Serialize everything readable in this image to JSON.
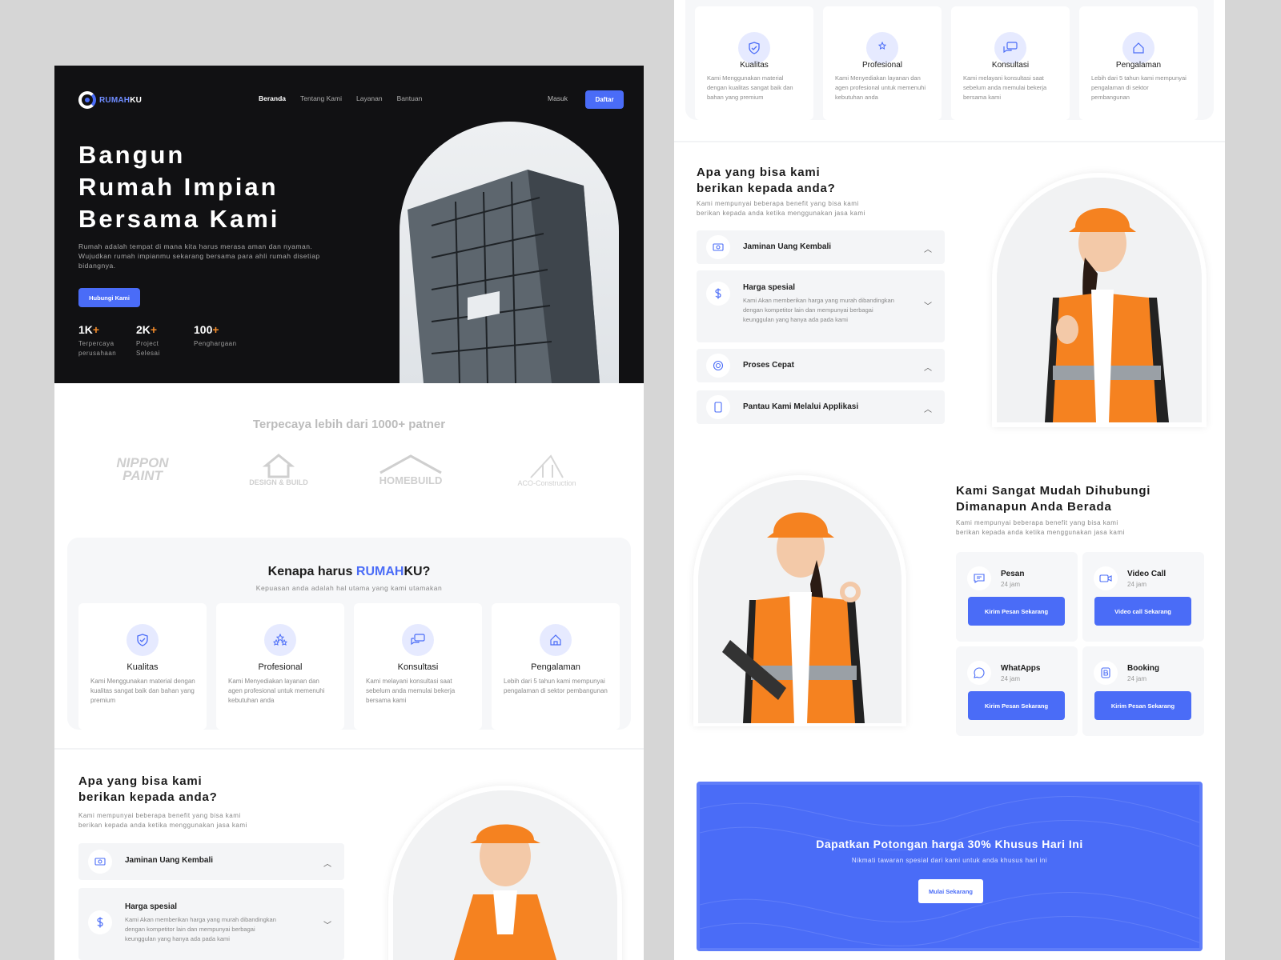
{
  "brand": {
    "part1": "RUMAH",
    "part2": "KU",
    "accent": "#4a6cf7",
    "orange": "#f48c2a"
  },
  "nav": {
    "items": [
      "Beranda",
      "Tentang Kami",
      "Layanan",
      "Bantuan"
    ],
    "login": "Masuk",
    "register": "Daftar"
  },
  "hero": {
    "title_lines": [
      "Bangun",
      "Rumah Impian",
      "Bersama Kami"
    ],
    "subtitle": "Rumah adalah tempat di mana kita harus merasa aman dan nyaman. Wujudkan rumah impianmu sekarang bersama para ahli rumah disetiap bidangnya.",
    "cta": "Hubungi Kami",
    "stats": [
      {
        "num": "1K",
        "plus": "+",
        "line1": "Terpercaya",
        "line2": "perusahaan"
      },
      {
        "num": "2K",
        "plus": "+",
        "line1": "Project",
        "line2": "Selesai"
      },
      {
        "num": "100",
        "plus": "+",
        "line1": "Penghargaan",
        "line2": ""
      }
    ]
  },
  "partners": {
    "title": "Terpecaya lebih dari 1000+ patner",
    "logos": [
      {
        "line1": "NIPPON",
        "line2": "PAINT",
        "icon": "nippon-logo"
      },
      {
        "line1": "DESIGN & BUILD",
        "icon": "house-logo"
      },
      {
        "line1": "HOMEBUILD",
        "icon": "roof-logo"
      },
      {
        "line1": "ACO-Construction",
        "icon": "frame-logo"
      }
    ]
  },
  "why": {
    "title_prefix": "Kenapa harus ",
    "title_brand": "RUMAH",
    "title_suffix": "KU?",
    "subtitle": "Kepuasan anda adalah hal utama yang kami utamakan",
    "cards": [
      {
        "title": "Kualitas",
        "desc": "Kami Menggunakan material dengan kualitas sangat baik dan bahan yang premium",
        "icon": "shield-icon"
      },
      {
        "title": "Profesional",
        "desc": "Kami Menyediakan layanan dan agen profesional untuk memenuhi kebutuhan anda",
        "icon": "stars-icon"
      },
      {
        "title": "Konsultasi",
        "desc": "Kami melayani konsultasi saat sebelum anda memulai bekerja bersama kami",
        "icon": "chat-icon"
      },
      {
        "title": "Pengalaman",
        "desc": "Lebih dari 5 tahun kami mempunyai pengalaman di sektor pembangunan",
        "icon": "home-icon"
      }
    ]
  },
  "benefits": {
    "title_line1": "Apa yang bisa kami",
    "title_line2": "berikan kepada anda?",
    "subtitle_line1": "Kami mempunyai beberapa benefit yang bisa kami",
    "subtitle_line2": "berikan kepada anda ketika menggunakan jasa kami",
    "items": [
      {
        "title": "Jaminan Uang Kembali",
        "icon": "money-icon"
      },
      {
        "title": "Harga spesial",
        "desc": "Kami Akan memberikan harga yang murah dibandingkan dengan kompetitor lain dan mempunyai berbagai keunggulan yang hanya ada pada kami",
        "icon": "dollar-icon"
      },
      {
        "title": "Proses Cepat",
        "icon": "speed-icon"
      },
      {
        "title": "Pantau Kami Melalui Applikasi",
        "icon": "phone-icon"
      }
    ]
  },
  "contact": {
    "title_line1": "Kami Sangat Mudah Dihubungi",
    "title_line2": "Dimanapun Anda Berada",
    "subtitle_line1": "Kami mempunyai beberapa benefit yang bisa kami",
    "subtitle_line2": "berikan kepada anda ketika menggunakan jasa kami",
    "cards": [
      {
        "name": "Pesan",
        "hours": "24 jam",
        "button": "Kirim Pesan Sekarang",
        "icon": "message-icon"
      },
      {
        "name": "Video Call",
        "hours": "24 jam",
        "button": "Video call Sekarang",
        "icon": "video-icon"
      },
      {
        "name": "WhatApps",
        "hours": "24 jam",
        "button": "Kirim Pesan Sekarang",
        "icon": "whatsapp-icon"
      },
      {
        "name": "Booking",
        "hours": "24 jam",
        "button": "Kirim Pesan Sekarang",
        "icon": "booking-icon"
      }
    ]
  },
  "promo": {
    "title": "Dapatkan Potongan harga 30% Khusus Hari Ini",
    "subtitle": "Nikmati tawaran spesial dari kami untuk anda khusus hari ini",
    "button": "Mulai Sekarang"
  }
}
